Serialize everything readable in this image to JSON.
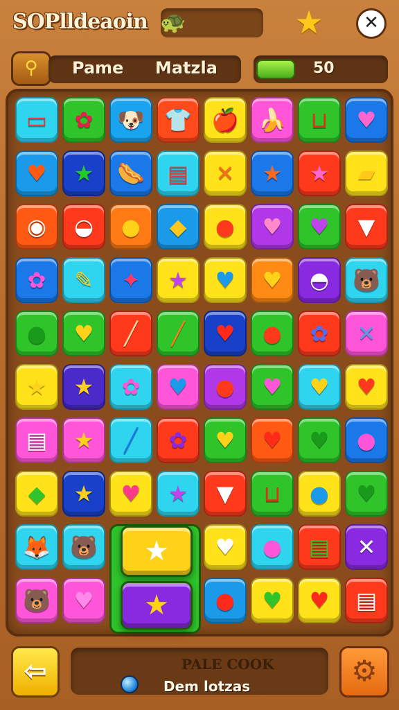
{
  "header": {
    "logo": "SOPlldeaoin",
    "gem_icon": "🐢",
    "star_icon": "★",
    "close_icon": "✕"
  },
  "info": {
    "key_icon": "⚲",
    "name_left": "Pame",
    "name_right": "Matzla",
    "score": "50",
    "progress_fraction": 0.3
  },
  "board": {
    "rows": [
      [
        {
          "c": "#2fd4ee",
          "g": "▭",
          "fg": "#e33"
        },
        {
          "c": "#2ec42a",
          "g": "✿",
          "fg": "#e91e4a"
        },
        {
          "c": "#1aa3ee",
          "g": "🐶",
          "fg": "#8b4513"
        },
        {
          "c": "#ff4a1c",
          "g": "👕",
          "fg": "#2a9be8"
        },
        {
          "c": "#ffe21a",
          "g": "🍎",
          "fg": "#e53"
        },
        {
          "c": "#ff55d8",
          "g": "🍌",
          "fg": "#ffd400"
        },
        {
          "c": "#2ec42a",
          "g": "⊔",
          "fg": "#e03018"
        },
        {
          "c": "#1a78e8",
          "g": "♥",
          "fg": "#ff66d0"
        }
      ],
      [
        {
          "c": "#1a9ae8",
          "g": "♥",
          "fg": "#ff5a14"
        },
        {
          "c": "#1840c8",
          "g": "★",
          "fg": "#22cc22"
        },
        {
          "c": "#1a78e8",
          "g": "🌭",
          "fg": "#ff8a1a"
        },
        {
          "c": "#2fd4ee",
          "g": "▤",
          "fg": "#e33"
        },
        {
          "c": "#ffe21a",
          "g": "✕",
          "fg": "#ff6a1a"
        },
        {
          "c": "#1a78e8",
          "g": "★",
          "fg": "#ff6a1a"
        },
        {
          "c": "#ff3a1c",
          "g": "★",
          "fg": "#ff66d0"
        },
        {
          "c": "#ffe21a",
          "g": "▰",
          "fg": "#ffc81a"
        }
      ],
      [
        {
          "c": "#ff5a14",
          "g": "◉",
          "fg": "#fff"
        },
        {
          "c": "#ff3a1c",
          "g": "◒",
          "fg": "#fff"
        },
        {
          "c": "#ff7a14",
          "g": "●",
          "fg": "#ffd21a"
        },
        {
          "c": "#1a9ae8",
          "g": "◆",
          "fg": "#ffc81a"
        },
        {
          "c": "#ffe21a",
          "g": "●",
          "fg": "#ff3a1c"
        },
        {
          "c": "#b038e8",
          "g": "♥",
          "fg": "#ff88c8"
        },
        {
          "c": "#2ec42a",
          "g": "♥",
          "fg": "#c044ee"
        },
        {
          "c": "#ff3a1c",
          "g": "▼",
          "fg": "#fff"
        }
      ],
      [
        {
          "c": "#1a78e8",
          "g": "✿",
          "fg": "#ff55d8"
        },
        {
          "c": "#2fd4ee",
          "g": "✎",
          "fg": "#ffd21a"
        },
        {
          "c": "#1a78e8",
          "g": "✦",
          "fg": "#ff3a6a"
        },
        {
          "c": "#ffe21a",
          "g": "★",
          "fg": "#c044ee"
        },
        {
          "c": "#ffe21a",
          "g": "♥",
          "fg": "#1a9ae8"
        },
        {
          "c": "#ff8a14",
          "g": "♥",
          "fg": "#ffd21a"
        },
        {
          "c": "#8a2ae0",
          "g": "◓",
          "fg": "#fff"
        },
        {
          "c": "#2fd4ee",
          "g": "🐻",
          "fg": "#ff9a1a"
        }
      ],
      [
        {
          "c": "#2ec42a",
          "g": "●",
          "fg": "#1a9a1a"
        },
        {
          "c": "#2ec42a",
          "g": "♥",
          "fg": "#ffd21a"
        },
        {
          "c": "#ff3a1c",
          "g": "╱",
          "fg": "#ffd9a0"
        },
        {
          "c": "#2ec42a",
          "g": "╱",
          "fg": "#ff7a1a"
        },
        {
          "c": "#1840c8",
          "g": "♥",
          "fg": "#ff2a1a"
        },
        {
          "c": "#2ec42a",
          "g": "●",
          "fg": "#ff3a1c"
        },
        {
          "c": "#ff3a1c",
          "g": "✿",
          "fg": "#5a6ae8"
        },
        {
          "c": "#ff55d8",
          "g": "✕",
          "fg": "#5a9ae8"
        }
      ],
      [
        {
          "c": "#ffe21a",
          "g": "★",
          "fg": "#ffd21a"
        },
        {
          "c": "#4a2ac8",
          "g": "★",
          "fg": "#ffd21a"
        },
        {
          "c": "#2fd4ee",
          "g": "✿",
          "fg": "#ff55d8"
        },
        {
          "c": "#ff55d8",
          "g": "♥",
          "fg": "#1a9ae8"
        },
        {
          "c": "#b038e8",
          "g": "●",
          "fg": "#ff3a1c"
        },
        {
          "c": "#2ec42a",
          "g": "♥",
          "fg": "#ff55d8"
        },
        {
          "c": "#2fd4ee",
          "g": "♥",
          "fg": "#ffd21a"
        },
        {
          "c": "#ffe21a",
          "g": "♥",
          "fg": "#ff3a1c"
        }
      ],
      [
        {
          "c": "#ff55d8",
          "g": "▤",
          "fg": "#fff"
        },
        {
          "c": "#ff55d8",
          "g": "★",
          "fg": "#ffd21a"
        },
        {
          "c": "#2fd4ee",
          "g": "╱",
          "fg": "#1a78e8"
        },
        {
          "c": "#ff3a1c",
          "g": "✿",
          "fg": "#8a2ae0"
        },
        {
          "c": "#2ec42a",
          "g": "♥",
          "fg": "#ffd21a"
        },
        {
          "c": "#ff5a14",
          "g": "♥",
          "fg": "#ff2a1a"
        },
        {
          "c": "#2ec42a",
          "g": "♥",
          "fg": "#1a9a1a"
        },
        {
          "c": "#1a78e8",
          "g": "●",
          "fg": "#ff55d8"
        }
      ],
      [
        {
          "c": "#ffe21a",
          "g": "◆",
          "fg": "#2ec42a"
        },
        {
          "c": "#1840c8",
          "g": "★",
          "fg": "#ffd21a"
        },
        {
          "c": "#ffe21a",
          "g": "♥",
          "fg": "#ff3a8a"
        },
        {
          "c": "#2fd4ee",
          "g": "★",
          "fg": "#c044ee"
        },
        {
          "c": "#ff3a1c",
          "g": "▼",
          "fg": "#fff"
        },
        {
          "c": "#2ec42a",
          "g": "⊔",
          "fg": "#e03018"
        },
        {
          "c": "#ffe21a",
          "g": "●",
          "fg": "#1a9ae8"
        },
        {
          "c": "#2ec42a",
          "g": "♥",
          "fg": "#1a9a1a"
        }
      ],
      [
        {
          "c": "#2fd4ee",
          "g": "🦊",
          "fg": "#c06a2a"
        },
        {
          "c": "#2fd4ee",
          "g": "🐻",
          "fg": "#ff9a1a"
        },
        {
          "c": "#2ec42a",
          "g": "",
          "fg": "#fff"
        },
        {
          "c": "#2ec42a",
          "g": "",
          "fg": "#fff"
        },
        {
          "c": "#ffe21a",
          "g": "♥",
          "fg": "#fff"
        },
        {
          "c": "#2fd4ee",
          "g": "●",
          "fg": "#ff55d8"
        },
        {
          "c": "#ff3a1c",
          "g": "▤",
          "fg": "#2ec42a"
        },
        {
          "c": "#8a2ae0",
          "g": "✕",
          "fg": "#fff"
        }
      ],
      [
        {
          "c": "#ff55d8",
          "g": "🐻",
          "fg": "#8b4513"
        },
        {
          "c": "#ff55d8",
          "g": "♥",
          "fg": "#ff88e8"
        },
        {
          "c": "#2ec42a",
          "g": "",
          "fg": "#fff"
        },
        {
          "c": "#2ec42a",
          "g": "",
          "fg": "#fff"
        },
        {
          "c": "#1a9ae8",
          "g": "●",
          "fg": "#ff2a1a"
        },
        {
          "c": "#ffe21a",
          "g": "♥",
          "fg": "#2ec42a"
        },
        {
          "c": "#ffe21a",
          "g": "♥",
          "fg": "#ff2a1a"
        },
        {
          "c": "#ff3a1c",
          "g": "▤",
          "fg": "#fff"
        }
      ]
    ],
    "special_top": {
      "color": "#ffd21a",
      "glyph": "★",
      "fg": "#fff"
    },
    "special_bottom": {
      "color": "#8a2ae0",
      "glyph": "★",
      "fg": "#ffd21a"
    }
  },
  "footer": {
    "back_icon": "⇦",
    "title": "PALE COOK",
    "text": "Dem lotzas",
    "gear_icon": "⚙"
  }
}
